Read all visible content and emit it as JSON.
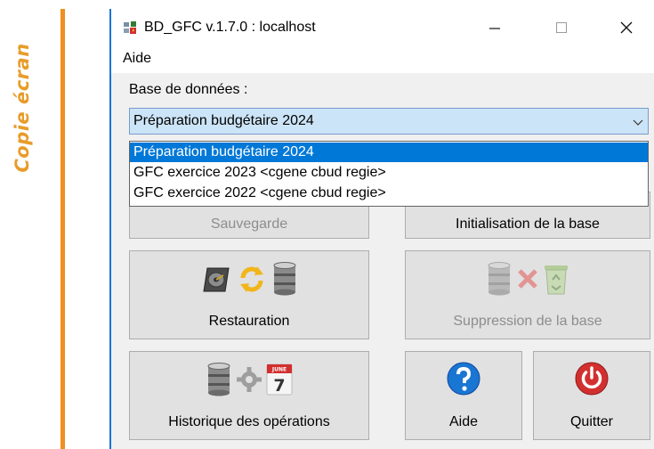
{
  "side_label": "Copie écran",
  "window": {
    "title": "BD_GFC v.1.7.0 : localhost",
    "controls": {
      "minimize": "—",
      "maximize": "☐",
      "close": "✕"
    }
  },
  "menu": {
    "items": [
      "Aide"
    ]
  },
  "database": {
    "label": "Base de données :",
    "selected": "Préparation budgétaire 2024",
    "options": [
      "Préparation budgétaire 2024",
      "GFC exercice 2023 <cgene cbud regie>",
      "GFC exercice 2022 <cgene cbud regie>"
    ]
  },
  "buttons": {
    "sauvegarde": {
      "label": "Sauvegarde",
      "enabled": false
    },
    "initialisation": {
      "label": "Initialisation de la base",
      "enabled": true
    },
    "restauration": {
      "label": "Restauration",
      "enabled": true,
      "icons": [
        "hard-drive-icon",
        "refresh-icon",
        "database-icon"
      ]
    },
    "suppression": {
      "label": "Suppression de la base",
      "enabled": false,
      "icons": [
        "database-icon",
        "delete-x-icon",
        "recycle-bin-icon"
      ]
    },
    "historique": {
      "label": "Historique des opérations",
      "enabled": true,
      "icons": [
        "database-icon",
        "gear-icon",
        "calendar-icon"
      ]
    },
    "aide": {
      "label": "Aide",
      "enabled": true,
      "icons": [
        "help-icon"
      ]
    },
    "quitter": {
      "label": "Quitter",
      "enabled": true,
      "icons": [
        "power-icon"
      ]
    }
  },
  "calendar_icon": {
    "month": "JUNE",
    "day": "7"
  },
  "colors": {
    "accent": "#0078d7",
    "side_label": "#e89c2a",
    "orange_bar": "#ef8f1f",
    "window_border": "#1b74d4"
  }
}
